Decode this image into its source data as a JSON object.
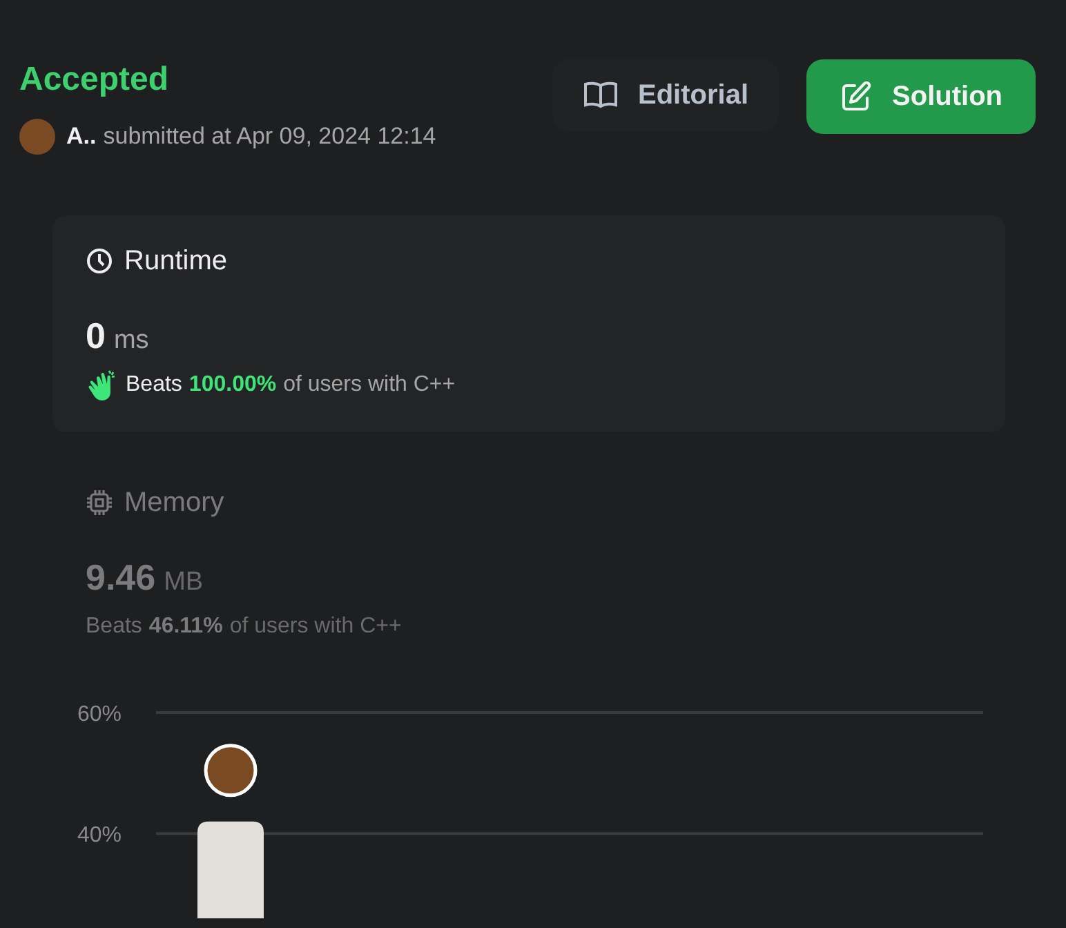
{
  "status": "Accepted",
  "author": {
    "name": "A..",
    "submitted": "submitted at Apr 09, 2024 12:14"
  },
  "buttons": [
    {
      "kind": "plain",
      "label": "Editorial"
    },
    {
      "kind": "primary",
      "label": "Solution"
    }
  ],
  "metrics": [
    {
      "kind": "runtime",
      "title": "Runtime",
      "selected": true,
      "value": "0",
      "unit": "ms",
      "beats_label": "Beats",
      "percent": "100.00%",
      "rest": "of users with C++"
    },
    {
      "kind": "memory",
      "title": "Memory",
      "selected": false,
      "value": "9.46",
      "unit": "MB",
      "beats_label": "Beats",
      "percent": "46.11%",
      "rest": "of users with C++"
    }
  ],
  "chart_data": {
    "type": "bar",
    "ylim": [
      26,
      60
    ],
    "yticks": [
      {
        "value": 40,
        "label": "40%"
      },
      {
        "value": 60,
        "label": "60%"
      }
    ],
    "values": [
      42
    ]
  }
}
